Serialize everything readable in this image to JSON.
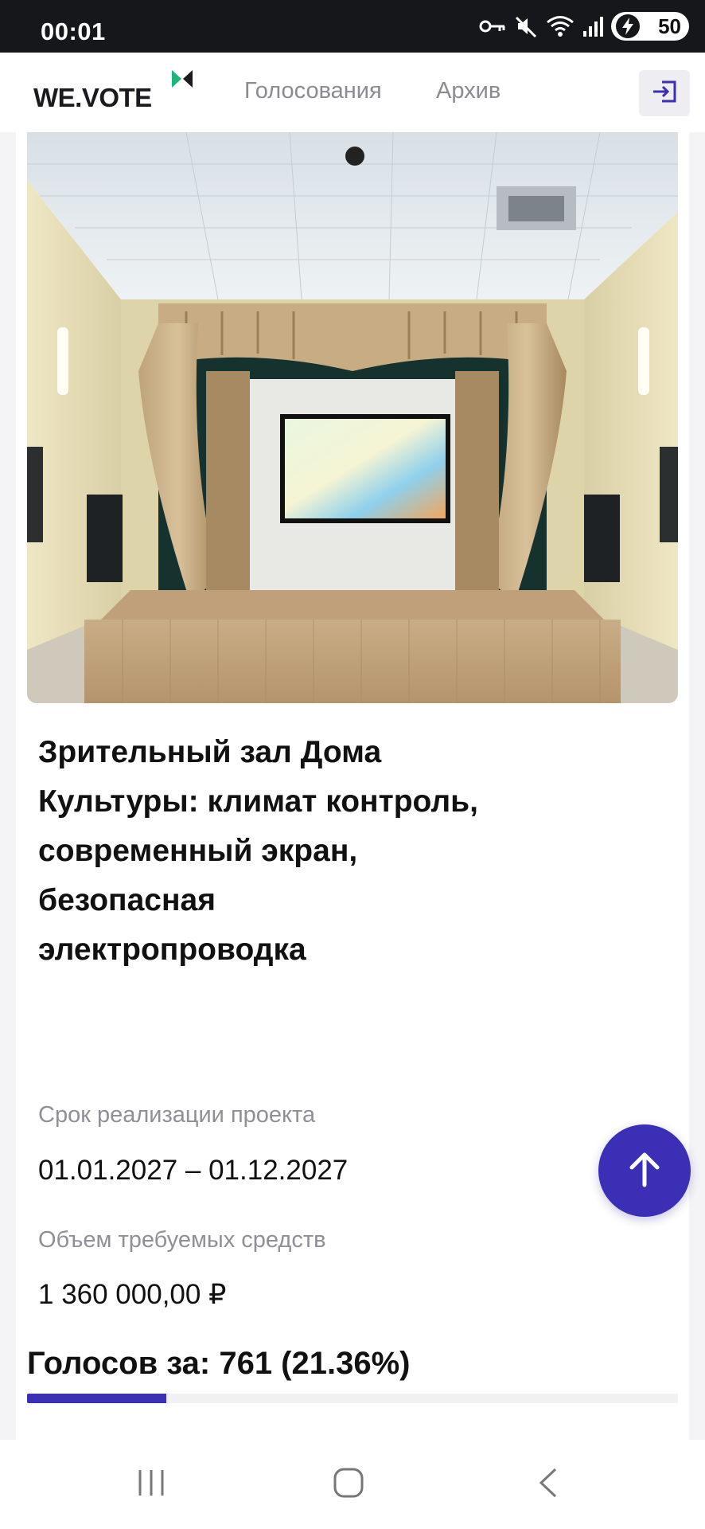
{
  "status_bar": {
    "time": "00:01",
    "battery": "50",
    "icons": [
      "key-icon",
      "mute-icon",
      "wifi-icon",
      "signal-icon",
      "charging-bolt-icon"
    ]
  },
  "header": {
    "logo_text": "WE.VOTE",
    "nav": {
      "votes": "Голосования",
      "archive": "Архив"
    },
    "login_icon": "login-icon",
    "accent_color": "#1fb47a"
  },
  "project": {
    "image_alt": "Зрительный зал Дома Культуры",
    "title": "Зрительный зал Дома Культуры: климат контроль, современный экран, безопасная электропроводка",
    "period_label": "Срок реализации проекта",
    "period_value": "01.01.2027 – 01.12.2027",
    "budget_label": "Объем требуемых средств",
    "budget_value": "1 360 000,00 ₽",
    "votes_text": "Голосов за: 761 (21.36%)",
    "votes_percent": 21.36,
    "progress_color": "#3a2fb5"
  },
  "scroll_top_icon": "arrow-up-icon",
  "system_nav": [
    "recents-icon",
    "home-icon",
    "back-icon"
  ]
}
